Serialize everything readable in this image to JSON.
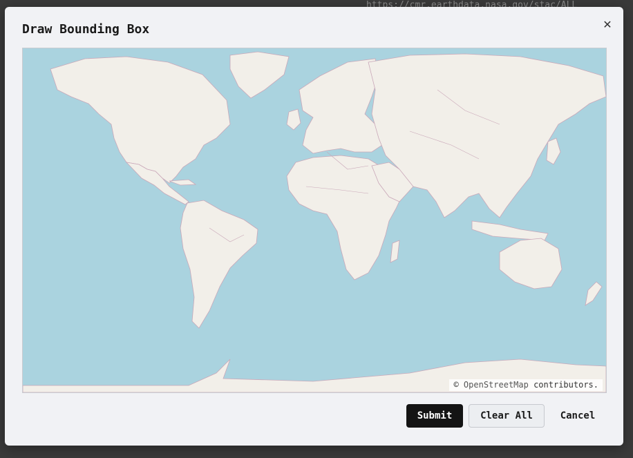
{
  "background": {
    "url_fragment": "https://cmr.earthdata.nasa.gov/stac/ALL"
  },
  "dialog": {
    "title": "Draw Bounding Box",
    "close_icon": "close-icon",
    "map": {
      "attribution_prefix": "©",
      "attribution_link": "OpenStreetMap",
      "attribution_suffix": "contributors."
    },
    "buttons": {
      "submit": "Submit",
      "clear_all": "Clear All",
      "cancel": "Cancel"
    }
  },
  "colors": {
    "ocean": "#aad3df",
    "land": "#f2efe9",
    "border": "#c9a7b8",
    "primary_button": "#141414"
  }
}
